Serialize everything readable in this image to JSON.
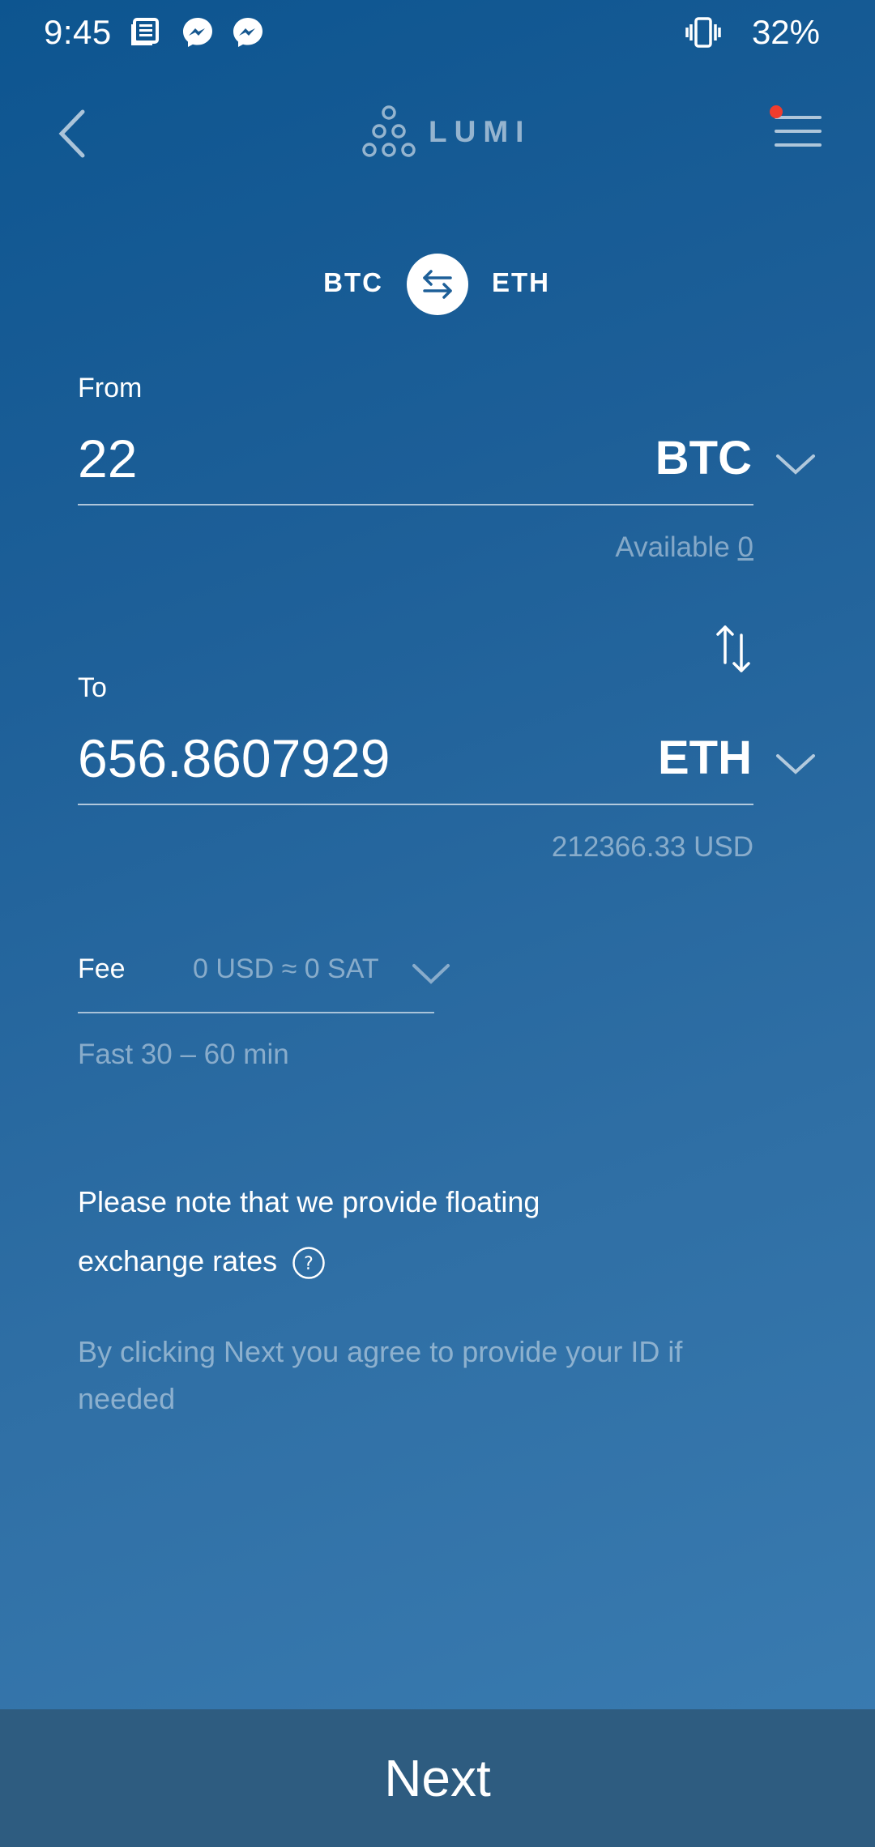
{
  "status_bar": {
    "time": "9:45",
    "battery": "32%",
    "icons": [
      "news-icon",
      "messenger-icon",
      "messenger-icon",
      "vibrate-icon"
    ]
  },
  "header": {
    "logo_text": "LUMI",
    "menu_has_notification": true,
    "notification_color": "#f03c2e"
  },
  "pair": {
    "from": "BTC",
    "to": "ETH"
  },
  "from": {
    "label": "From",
    "amount": "22",
    "currency": "BTC",
    "available_label": "Available",
    "available_value": "0"
  },
  "to": {
    "label": "To",
    "amount": "656.8607929",
    "currency": "ETH",
    "usd_value": "212366.33 USD"
  },
  "fee": {
    "label": "Fee",
    "value": "0 USD ≈ 0 SAT",
    "speed": "Fast 30 – 60 min"
  },
  "notes": {
    "floating_line1": "Please note that we provide floating",
    "floating_line2": "exchange rates",
    "agree": "By clicking Next you agree to provide your ID if needed"
  },
  "next_button": {
    "label": "Next"
  },
  "colors": {
    "background_top": "#0d5590",
    "background_bottom": "#3b7db2",
    "next_button_bg": "#2e5c80"
  }
}
